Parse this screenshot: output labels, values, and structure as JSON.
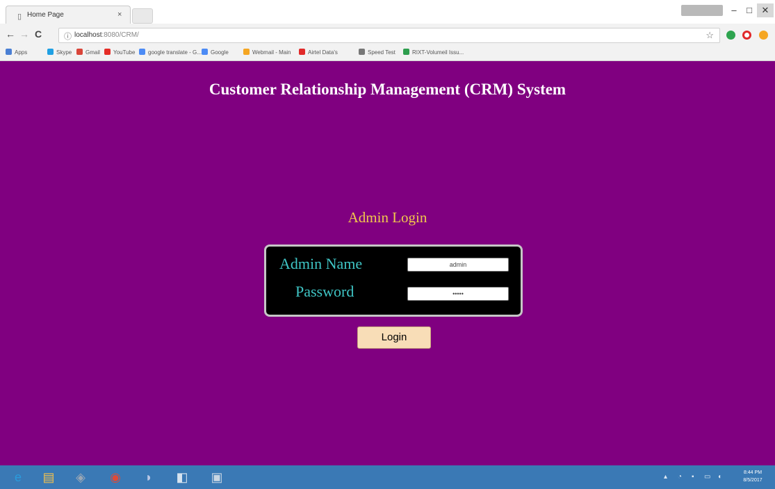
{
  "browser": {
    "tab_title": "Home Page",
    "tab_close": "×",
    "window_buttons": {
      "minimize": "–",
      "maximize": "□",
      "close": "✕"
    },
    "back": "←",
    "forward": "→",
    "reload": "C",
    "info_icon": "ⓘ",
    "url_host": "localhost",
    "url_rest": ":8080/CRM/",
    "star": "☆",
    "bookmarks": [
      {
        "label": "Apps",
        "color": "#4a7fd4"
      },
      {
        "label": "Skype",
        "color": "#1fa0e3"
      },
      {
        "label": "Gmail",
        "color": "#d9453a"
      },
      {
        "label": "YouTube",
        "color": "#e52d27"
      },
      {
        "label": "google translate - G...",
        "color": "#4c8bf5"
      },
      {
        "label": "Google",
        "color": "#4c8bf5"
      },
      {
        "label": "Webmail - Main",
        "color": "#f5a623"
      },
      {
        "label": "Airtel Data's",
        "color": "#e12a2a"
      },
      {
        "label": "Speed Test",
        "color": "#777777"
      },
      {
        "label": "RIXT-Volumeil Issu...",
        "color": "#2e9e4e"
      }
    ]
  },
  "page": {
    "title": "Customer Relationship Management (CRM) System",
    "login_heading": "Admin Login",
    "form": {
      "admin_name_label": "Admin Name",
      "admin_name_value": "admin",
      "password_label": "Password",
      "password_value": "•••••"
    },
    "login_button": "Login"
  },
  "colors": {
    "page_background": "#800080",
    "title_text": "#ffffff",
    "heading_text": "#f2c94c",
    "label_text": "#3fc5c5",
    "form_background": "#000000",
    "button_background": "#f8ddb7",
    "taskbar": "#3a79b5"
  },
  "taskbar": {
    "apps": [
      {
        "icon": "internet-explorer-icon",
        "glyph": "e"
      },
      {
        "icon": "file-explorer-icon",
        "glyph": "▤"
      },
      {
        "icon": "app-icon",
        "glyph": "◈"
      },
      {
        "icon": "chrome-icon",
        "glyph": "◉"
      },
      {
        "icon": "app-icon",
        "glyph": "◗"
      },
      {
        "icon": "virtualbox-icon",
        "glyph": "◧"
      },
      {
        "icon": "app-icon",
        "glyph": "▣"
      }
    ],
    "clock_time": "8:44 PM",
    "clock_date": "8/5/2017"
  }
}
